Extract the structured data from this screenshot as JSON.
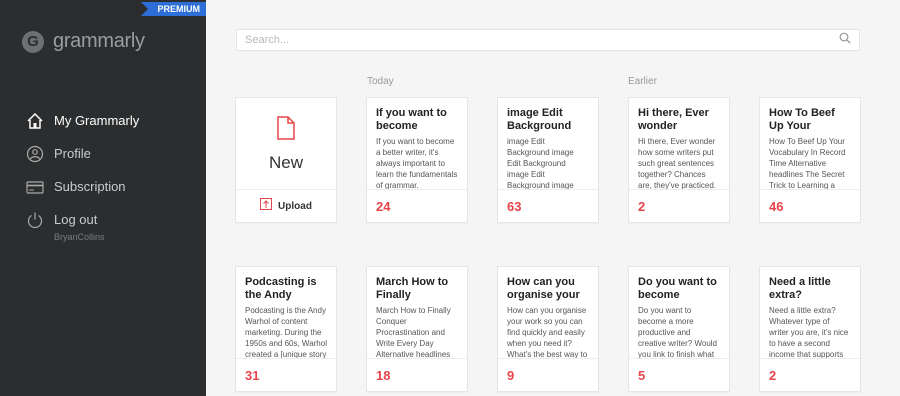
{
  "sidebar": {
    "badge": "PREMIUM",
    "logo_text": "grammarly",
    "items": [
      {
        "label": "My Grammarly"
      },
      {
        "label": "Profile"
      },
      {
        "label": "Subscription"
      },
      {
        "label": "Log out"
      }
    ],
    "username": "BryanCollins"
  },
  "search": {
    "placeholder": "Search..."
  },
  "sections": {
    "today": "Today",
    "earlier": "Earlier"
  },
  "new_card": {
    "label": "New",
    "upload_label": "Upload"
  },
  "documents": [
    {
      "title": "If you want to become",
      "preview": "If you want to become a better writer, it's always important to learn the fundamentals of grammar.",
      "count": "24"
    },
    {
      "title": "image Edit Background",
      "preview": "image Edit Background image Edit Background image Edit Background image Edit Background",
      "count": "63"
    },
    {
      "title": "Hi there, Ever wonder",
      "preview": "Hi there, Ever wonder how some writers put such great sentences together? Chances are, they've practiced. Find",
      "count": "2"
    },
    {
      "title": "How To Beef Up Your",
      "preview": "How To Beef Up Your Vocabulary In Record Time Alternative headlines The Secret Trick to Learning a",
      "count": "46"
    },
    {
      "title": "Podcasting is the Andy",
      "preview": "Podcasting is the Andy Warhol of content marketing. During the 1950s and 60s, Warhol created a [unique story",
      "count": "31"
    },
    {
      "title": "March How to Finally",
      "preview": "March How to Finally Conquer Procrastination and Write Every Day Alternative headlines",
      "count": "18"
    },
    {
      "title": "How can you organise your",
      "preview": "How can you organise your work so you can find quickly and easily when you need it? What's the best way to",
      "count": "9"
    },
    {
      "title": "Do you want to become",
      "preview": "Do you want to become a more productive and creative writer? Would you link to finish what you",
      "count": "5"
    },
    {
      "title": "Need a little extra?",
      "preview": "Need a little extra? Whatever type of writer you are, it's nice to have a second income that supports",
      "count": "2"
    }
  ],
  "colors": {
    "accent": "#e6454b",
    "sidebar_bg": "#2b2d2f",
    "badge_bg": "#2d6fd6"
  }
}
